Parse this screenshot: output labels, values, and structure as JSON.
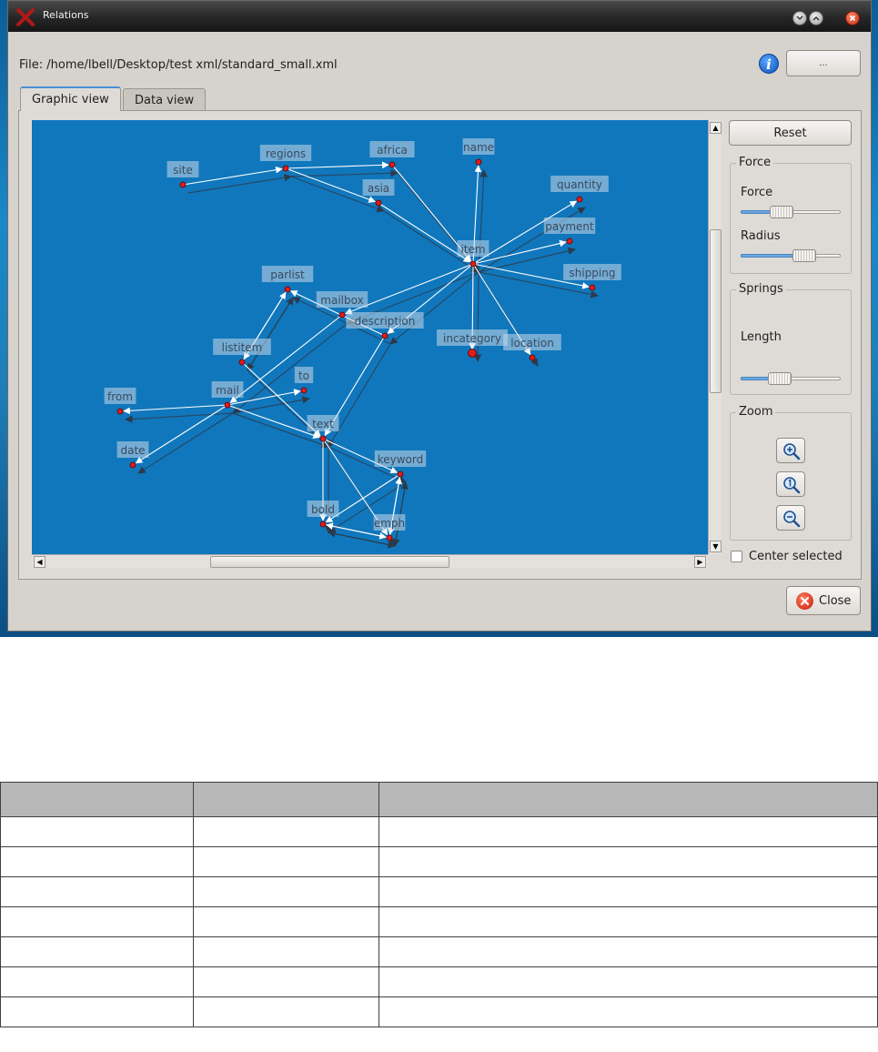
{
  "window": {
    "title": "Relations"
  },
  "file": {
    "label": "File:  /home/lbell/Desktop/test xml/standard_small.xml",
    "browse_label": "..."
  },
  "tabs": [
    {
      "label": "Graphic view",
      "active": true
    },
    {
      "label": "Data view",
      "active": false
    }
  ],
  "graph": {
    "background_color": "#1077bc",
    "nodes": [
      {
        "id": "site",
        "label": "site"
      },
      {
        "id": "regions",
        "label": "regions"
      },
      {
        "id": "africa",
        "label": "africa"
      },
      {
        "id": "asia",
        "label": "asia"
      },
      {
        "id": "name",
        "label": "name"
      },
      {
        "id": "quantity",
        "label": "quantity"
      },
      {
        "id": "payment",
        "label": "payment"
      },
      {
        "id": "item",
        "label": "item"
      },
      {
        "id": "shipping",
        "label": "shipping"
      },
      {
        "id": "parlist",
        "label": "parlist"
      },
      {
        "id": "mailbox",
        "label": "mailbox"
      },
      {
        "id": "description",
        "label": "description"
      },
      {
        "id": "incategory",
        "label": "incategory"
      },
      {
        "id": "location",
        "label": "location"
      },
      {
        "id": "listitem",
        "label": "listitem"
      },
      {
        "id": "to",
        "label": "to"
      },
      {
        "id": "from",
        "label": "from"
      },
      {
        "id": "mail",
        "label": "mail"
      },
      {
        "id": "text",
        "label": "text"
      },
      {
        "id": "date",
        "label": "date"
      },
      {
        "id": "keyword",
        "label": "keyword"
      },
      {
        "id": "bold",
        "label": "bold"
      },
      {
        "id": "emph",
        "label": "emph"
      }
    ],
    "edges": [
      [
        "site",
        "regions"
      ],
      [
        "regions",
        "africa"
      ],
      [
        "regions",
        "asia"
      ],
      [
        "africa",
        "item"
      ],
      [
        "asia",
        "item"
      ],
      [
        "item",
        "name"
      ],
      [
        "item",
        "quantity"
      ],
      [
        "item",
        "payment"
      ],
      [
        "item",
        "shipping"
      ],
      [
        "item",
        "location"
      ],
      [
        "item",
        "incategory"
      ],
      [
        "item",
        "mailbox"
      ],
      [
        "item",
        "description"
      ],
      [
        "mailbox",
        "mail"
      ],
      [
        "description",
        "parlist"
      ],
      [
        "description",
        "text"
      ],
      [
        "parlist",
        "listitem"
      ],
      [
        "listitem",
        "text"
      ],
      [
        "listitem",
        "parlist"
      ],
      [
        "mail",
        "from"
      ],
      [
        "mail",
        "to"
      ],
      [
        "mail",
        "date"
      ],
      [
        "mail",
        "text"
      ],
      [
        "text",
        "keyword"
      ],
      [
        "text",
        "bold"
      ],
      [
        "text",
        "emph"
      ],
      [
        "keyword",
        "bold"
      ],
      [
        "keyword",
        "emph"
      ],
      [
        "bold",
        "emph"
      ],
      [
        "emph",
        "keyword"
      ],
      [
        "emph",
        "bold"
      ]
    ]
  },
  "controls": {
    "reset_label": "Reset",
    "force_group": "Force",
    "force_label": "Force",
    "force_value": 0.38,
    "radius_label": "Radius",
    "radius_value": 0.68,
    "springs_group": "Springs",
    "length_label": "Length",
    "length_value": 0.36,
    "zoom_group": "Zoom",
    "center_selected_label": "Center selected",
    "center_selected_checked": false
  },
  "footer": {
    "close_label": "Close"
  },
  "table": {
    "columns": 3,
    "rows": 7
  }
}
